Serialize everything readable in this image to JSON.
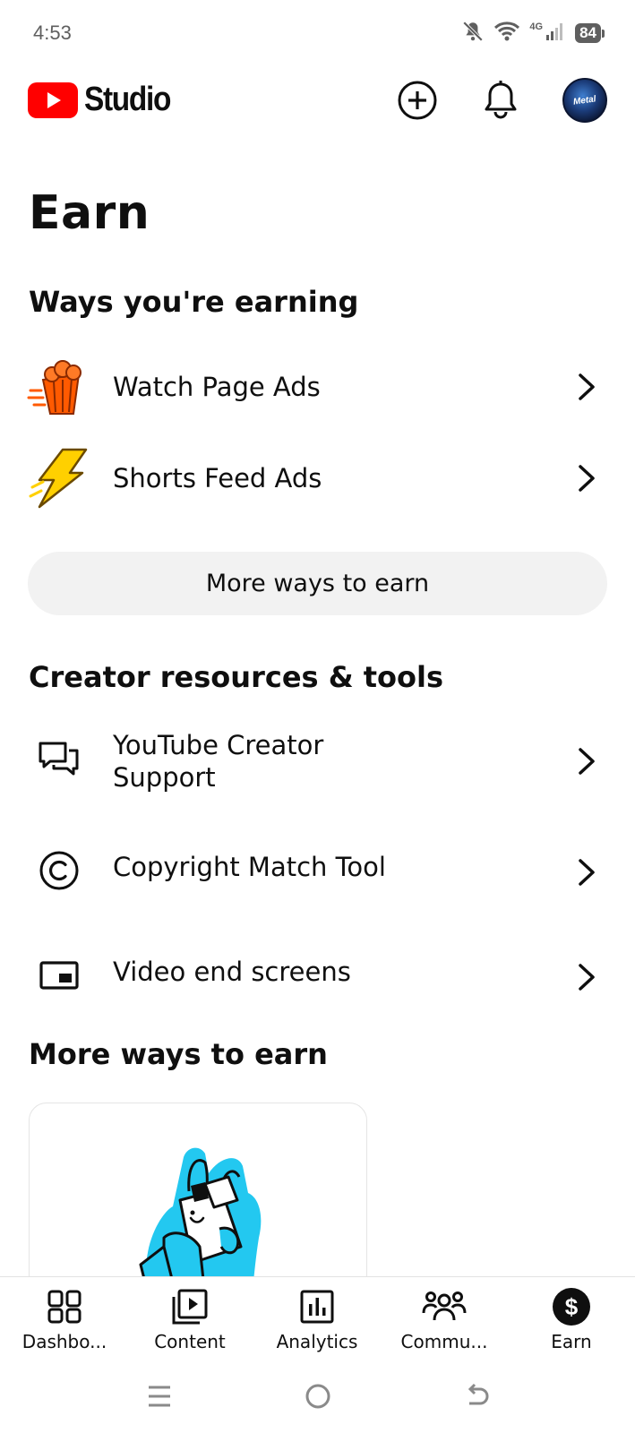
{
  "status_bar": {
    "time": "4:53",
    "network": "4G",
    "battery": "84"
  },
  "header": {
    "logo_text": "Studio",
    "avatar_text": "Metal"
  },
  "page": {
    "title": "Earn"
  },
  "earning": {
    "title": "Ways you're earning",
    "items": [
      {
        "label": "Watch Page Ads",
        "icon": "popcorn-icon"
      },
      {
        "label": "Shorts Feed Ads",
        "icon": "lightning-bolt-icon"
      }
    ],
    "more_button": "More ways to earn"
  },
  "resources": {
    "title": "Creator resources & tools",
    "items": [
      {
        "label": "YouTube Creator Support",
        "icon": "chat-bubbles-icon"
      },
      {
        "label": "Copyright Match Tool",
        "icon": "copyright-icon"
      },
      {
        "label": "Video end screens",
        "icon": "end-screen-icon"
      }
    ]
  },
  "more_ways": {
    "title": "More ways to earn"
  },
  "bottom_nav": {
    "items": [
      {
        "label": "Dashbo...",
        "icon": "dashboard-icon"
      },
      {
        "label": "Content",
        "icon": "content-icon"
      },
      {
        "label": "Analytics",
        "icon": "analytics-icon"
      },
      {
        "label": "Commu...",
        "icon": "community-icon"
      },
      {
        "label": "Earn",
        "icon": "earn-icon",
        "active": true
      }
    ]
  },
  "colors": {
    "youtube_red": "#ff0000",
    "popcorn_orange": "#ff5a00",
    "bolt_yellow": "#ffd000",
    "card_art_blue": "#23c8f0"
  }
}
